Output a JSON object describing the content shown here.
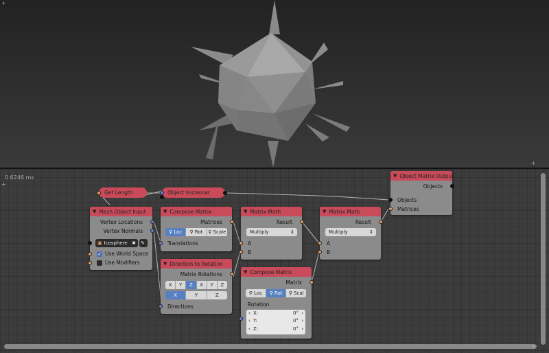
{
  "viewport": {
    "label": "3d-viewport"
  },
  "editor": {
    "timing": "0.6246 ms",
    "nodes": {
      "get_length": {
        "title": "Get Length"
      },
      "object_instancer": {
        "title": "Object Instancer"
      },
      "object_matrix_output": {
        "title": "Object Matrix Output",
        "in_objects": "Objects",
        "in_objects2": "Objects",
        "in_matrices": "Matrices"
      },
      "mesh_object_input": {
        "title": "Mesh Object Input",
        "out_vertex_locations": "Vertex Locations",
        "out_vertex_normals": "Vertex Normals",
        "object_value": "Icosphere",
        "use_world_space": "Use World Space",
        "use_modifiers": "Use Modifiers"
      },
      "compose_matrix_1": {
        "title": "Compose Matrix",
        "out_matrices": "Matrices",
        "btn_loc": "Loc",
        "btn_rot": "Rot",
        "btn_scale": "Scale",
        "in_translations": "Translations"
      },
      "matrix_math_1": {
        "title": "Matrix Math",
        "out_result": "Result",
        "operation": "Multiply",
        "in_a": "A",
        "in_b": "B"
      },
      "matrix_math_2": {
        "title": "Matrix Math",
        "out_result": "Result",
        "operation": "Multiply",
        "in_a": "A",
        "in_b": "B"
      },
      "direction_to_rotation": {
        "title": "Direction to Rotation",
        "out_matrix_rotations": "Matrix Rotations",
        "axis1": [
          "X",
          "Y",
          "Z",
          "X",
          "Y",
          "Z"
        ],
        "axis2": [
          "X",
          "Y",
          "Z"
        ],
        "in_directions": "Directions"
      },
      "compose_matrix_2": {
        "title": "Compose Matrix",
        "out_matrix": "Matrix",
        "btn_loc": "Loc",
        "btn_rot": "Rot",
        "btn_scale": "Scal",
        "rotation_label": "Rotation",
        "x_label": "X:",
        "x_value": "0°",
        "y_label": "Y:",
        "y_value": "0°",
        "z_label": "Z:",
        "z_value": "0°"
      }
    }
  },
  "colors": {
    "node_header": "#c94b5a",
    "node_body": "#8b8b8b",
    "socket_blue": "#6a7fd6",
    "socket_orange": "#e0a060",
    "selected_button": "#5680c2"
  }
}
